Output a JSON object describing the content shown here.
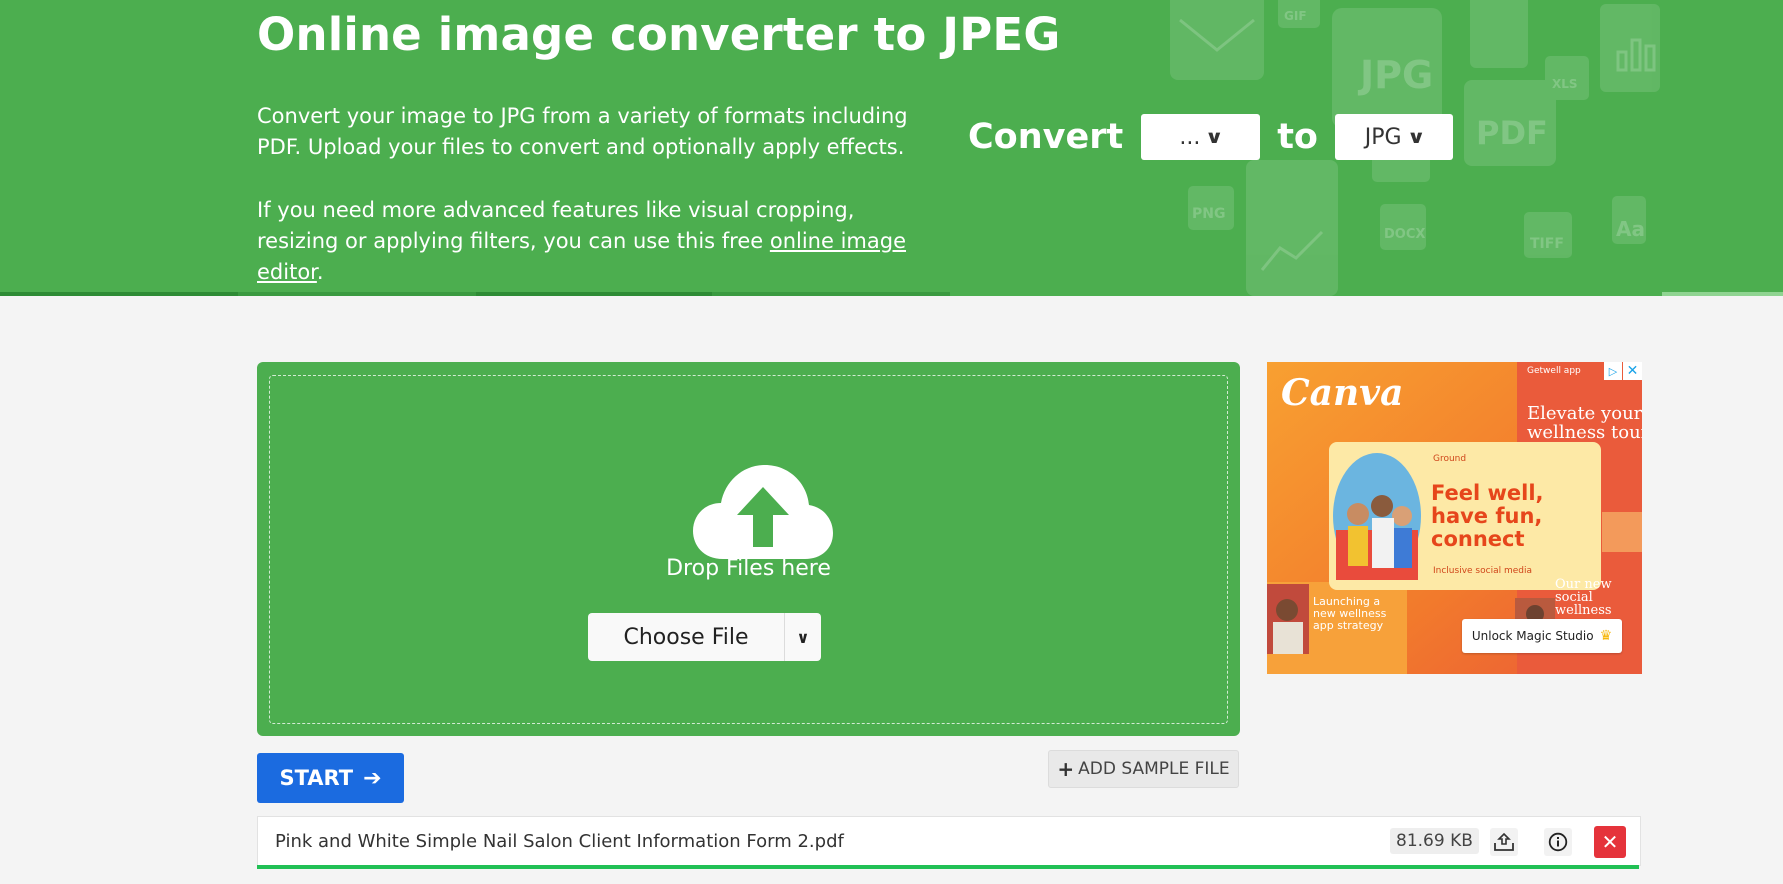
{
  "hero": {
    "title": "Online image converter to JPEG",
    "paragraph1": "Convert your image to JPG from a variety of formats including PDF. Upload your files to convert and optionally apply effects.",
    "paragraph2_prefix": "If you need more advanced features like visual cropping, resizing or applying filters, you can use this free ",
    "paragraph2_link": "online image editor",
    "paragraph2_suffix": ".",
    "convert_label": "Convert",
    "to_label": "to",
    "from_format": "...",
    "to_format": "JPG",
    "background_icons": [
      "envelope-icon",
      "gif-file-icon",
      "jpg-file-icon",
      "image-file-icon",
      "chart-file-icon",
      "xls-file-icon",
      "pdf-file-icon",
      "printer-icon",
      "png-file-icon",
      "line-chart-file-icon",
      "docx-file-icon",
      "tiff-file-icon",
      "font-file-icon"
    ]
  },
  "dropzone": {
    "label": "Drop Files here",
    "choose_file": "Choose File",
    "icon": "cloud-upload-icon"
  },
  "actions": {
    "start": "START",
    "add_sample": "ADD SAMPLE FILE"
  },
  "file": {
    "name": "Pink and White Simple Nail Salon Client Information Form 2.pdf",
    "size": "81.69 KB",
    "progress_percent": 100
  },
  "ad": {
    "brand": "Canva",
    "sponsor": "Getwell app",
    "elevate": "Elevate your wellness tour",
    "card_brand": "Ground",
    "headline": "Feel well, have fun, connect",
    "card_sub": "Inclusive social media",
    "side_text": "Launching a new wellness app strategy",
    "right_text": "Our new social wellness",
    "cta": "Unlock Magic Studio"
  },
  "colors": {
    "hero_green": "#4cae4f",
    "start_blue": "#1b6be0",
    "remove_red": "#e5333b",
    "progress_green": "#21c055"
  }
}
